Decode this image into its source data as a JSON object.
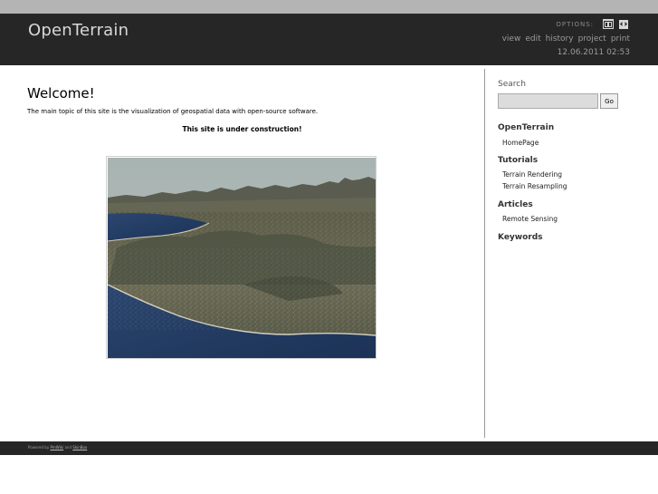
{
  "header": {
    "title": "OpenTerrain",
    "options_label": "OPTIONS:",
    "option_icons": [
      "layout-wide-icon",
      "layout-fixed-icon"
    ],
    "links": [
      "view",
      "edit",
      "history",
      "project",
      "print"
    ],
    "datetime": "12.06.2011 02:53"
  },
  "main": {
    "heading": "Welcome!",
    "intro": "The main topic of this site is the visualization of geospatial data with open-source software.",
    "notice": "This site is under construction!"
  },
  "sidebar": {
    "search_heading": "Search",
    "search_placeholder": "",
    "search_button": "Go",
    "sections": [
      {
        "heading": "OpenTerrain",
        "items": [
          "HomePage"
        ]
      },
      {
        "heading": "Tutorials",
        "items": [
          "Terrain Rendering",
          "Terrain Resampling"
        ]
      },
      {
        "heading": "Articles",
        "items": [
          "Remote Sensing"
        ]
      },
      {
        "heading": "Keywords",
        "items": []
      }
    ]
  },
  "footer": {
    "prefix": "Powered by",
    "link1": "PmWiki",
    "middle": "and",
    "link2": "SkinBox"
  },
  "colors": {
    "header_bg": "#262626",
    "top_strip": "#b4b4b4",
    "title_text": "#d8d8d8",
    "link_text": "#9a9a9a"
  }
}
